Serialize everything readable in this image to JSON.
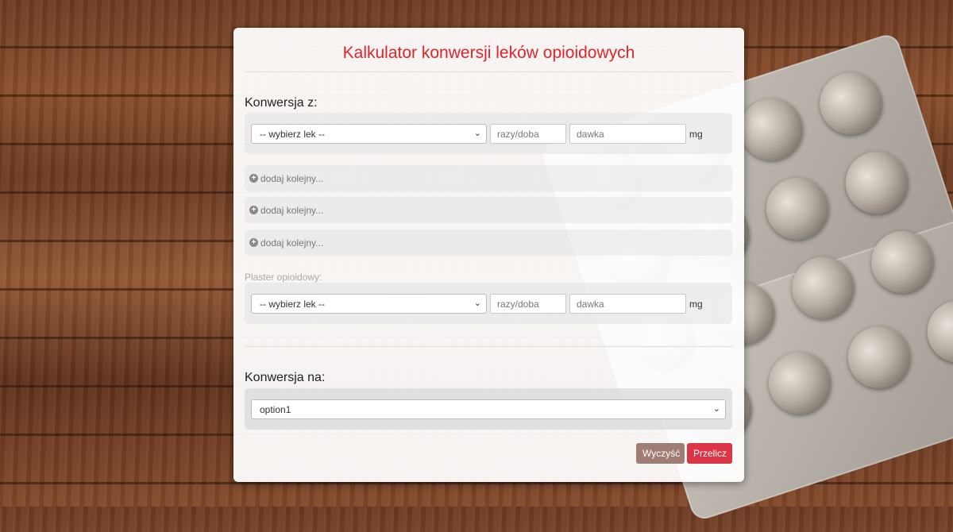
{
  "title": "Kalkulator konwersji leków opioidowych",
  "conversion_from": {
    "label": "Konwersja z:",
    "select_value": "-- wybierz lek --",
    "frequency_placeholder": "razy/doba",
    "dose_placeholder": "dawka",
    "unit": "mg"
  },
  "add_rows": [
    {
      "label": "dodaj kolejny..."
    },
    {
      "label": "dodaj kolejny..."
    },
    {
      "label": "dodaj kolejny..."
    }
  ],
  "patch": {
    "label": "Plaster opioidowy:",
    "select_value": "-- wybierz lek --",
    "frequency_placeholder": "razy/doba",
    "dose_placeholder": "dawka",
    "unit": "mg"
  },
  "conversion_to": {
    "label": "Konwersja na:",
    "select_value": "option1"
  },
  "buttons": {
    "clear_label": "Wyczyść",
    "calculate_label": "Przelicz"
  },
  "colors": {
    "accent": "#e0242c",
    "clear_button": "#a07d74",
    "calculate_button": "#dc3545"
  },
  "icons": {
    "add": "plus-circle-icon",
    "dropdown": "chevron-down-icon"
  }
}
